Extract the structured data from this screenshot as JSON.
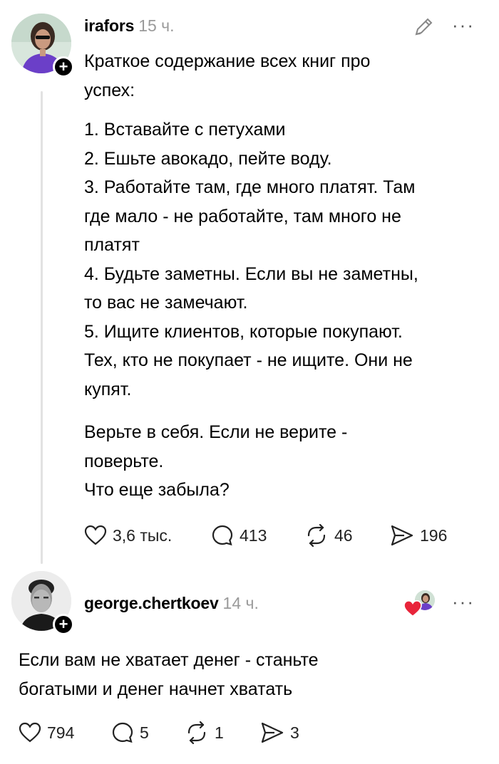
{
  "post": {
    "username": "irafors",
    "time": "15 ч.",
    "text_intro": "Краткое содержание всех книг про\nуспех:",
    "text_list": "1. Вставайте с петухами\n2. Ешьте авокадо, пейте воду.\n3. Работайте там, где много платят. Там\nгде мало - не работайте, там много не\nплатят\n4. Будьте заметны. Если вы не заметны,\nто вас не замечают.\n5. Ищите клиентов, которые покупают.\nТех, кто не покупает - не ищите. Они не\nкупят.",
    "text_outro": "Верьте в себя. Если не верите -\nповерьте.\nЧто еще забыла?",
    "likes": "3,6 тыс.",
    "comments": "413",
    "reposts": "46",
    "shares": "196"
  },
  "reply": {
    "username": "george.chertkoev",
    "time": "14 ч.",
    "text": "Если вам не хватает денег - станьте\nбогатыми и денег начнет хватать",
    "likes": "794",
    "comments": "5",
    "reposts": "1",
    "shares": "3"
  },
  "icons": {
    "more": "more-horizontal-icon",
    "edit": "pencil-icon",
    "like": "heart-icon",
    "comment": "comment-bubble-icon",
    "repost": "repost-icon",
    "share": "send-icon",
    "follow": "plus-icon"
  },
  "colors": {
    "time_gray": "#9a9a9a",
    "liked_heart": "#e8243a",
    "thread_line": "#e2e2e2"
  }
}
